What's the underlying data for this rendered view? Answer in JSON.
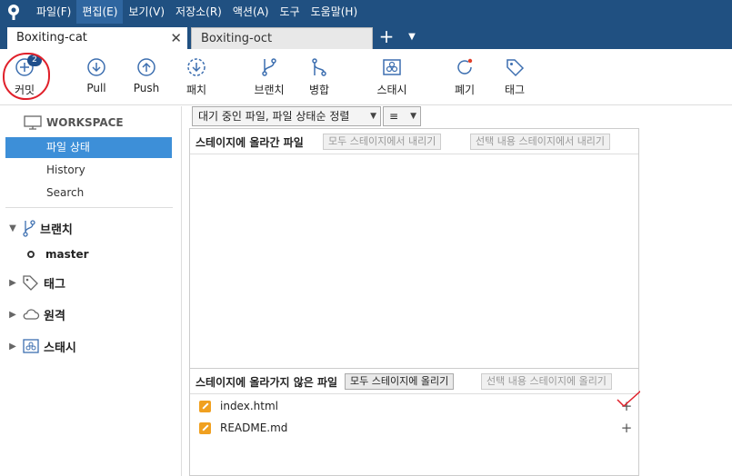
{
  "menu": [
    "파일(F)",
    "편집(E)",
    "보기(V)",
    "저장소(R)",
    "액션(A)",
    "도구",
    "도움말(H)"
  ],
  "tabs": [
    {
      "label": "Boxiting-cat",
      "active": true
    },
    {
      "label": "Boxiting-oct",
      "active": false
    }
  ],
  "toolbar": {
    "commit": {
      "label": "커밋",
      "badge": "2"
    },
    "pull": "Pull",
    "push": "Push",
    "fetch": "패치",
    "branch": "브랜치",
    "merge": "병합",
    "stash": "스태시",
    "discard": "폐기",
    "tag": "태그"
  },
  "sidebar": {
    "workspace": "WORKSPACE",
    "items": [
      "파일 상태",
      "History",
      "Search"
    ],
    "branches": "브랜치",
    "current_branch": "master",
    "tags": "태그",
    "remotes": "원격",
    "stashes": "스태시"
  },
  "filter": {
    "status_dropdown": "대기 중인 파일, 파일 상태순 정렬",
    "view_dropdown": "≡"
  },
  "staged": {
    "title": "스테이지에 올라간 파일",
    "unstage_all": "모두 스테이지에서 내리기",
    "unstage_selected": "선택 내용 스테이지에서 내리기"
  },
  "unstaged": {
    "title": "스테이지에 올라가지 않은 파일",
    "stage_all": "모두 스테이지에 올리기",
    "stage_selected": "선택 내용 스테이지에 올리기",
    "files": [
      "index.html",
      "README.md"
    ]
  },
  "colors": {
    "menubar": "#205081",
    "selected": "#3d8fd8",
    "modified": "#f0a020",
    "annotation": "#e0202a"
  }
}
